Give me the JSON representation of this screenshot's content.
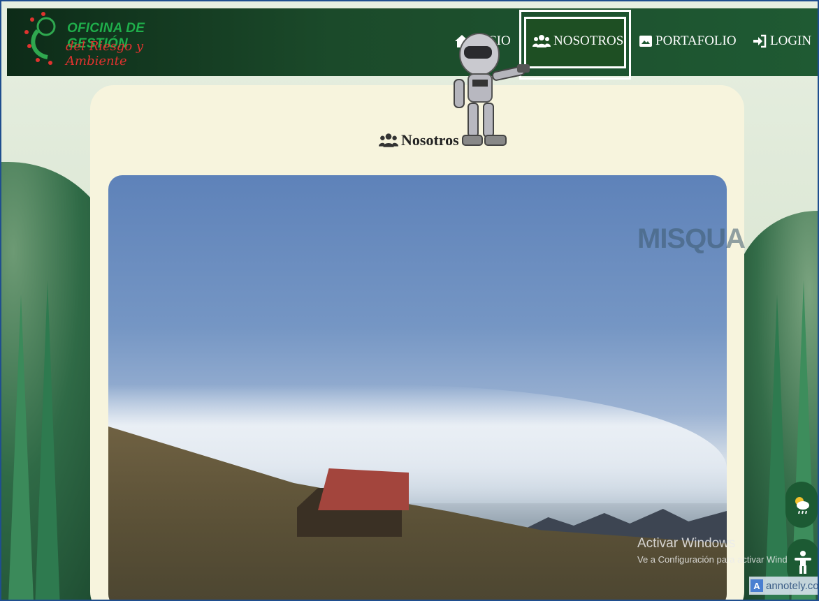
{
  "brand": {
    "title": "OFICINA DE GESTIÓN",
    "subtitle": "del Riesgo y Ambiente"
  },
  "nav": {
    "inicio": "INICIO",
    "inicio_visible": "CIO",
    "nosotros": "NOSOTROS",
    "portafolio": "PORTAFOLIO",
    "login": "LOGIN"
  },
  "card": {
    "title": "Nosotros"
  },
  "photo": {
    "watermark": "MISQUA"
  },
  "os_notice": {
    "title": "Activar Windows",
    "subtitle": "Ve a Configuración para activar Windows."
  },
  "badge": {
    "label": "annotely.com"
  },
  "colors": {
    "header_bg": "#1b4a2a",
    "brand_green": "#1fae4b",
    "brand_red": "#e0332f",
    "card_bg": "#f7f4dd",
    "fab_bg": "#1c5a33"
  }
}
